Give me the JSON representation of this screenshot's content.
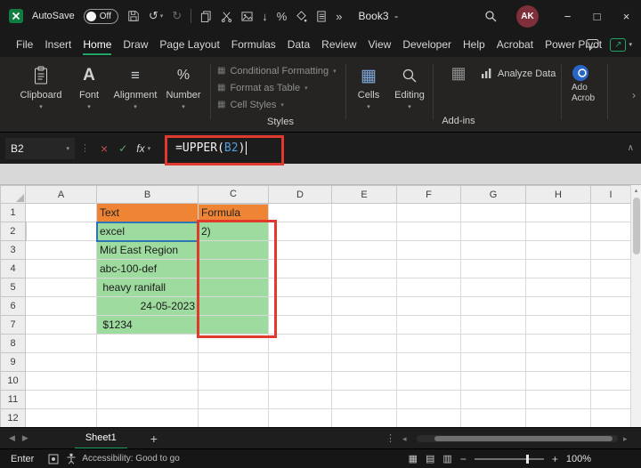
{
  "colors": {
    "excel_green": "#107C41",
    "accent_green": "#21A366",
    "header_orange": "#EE8434",
    "cell_green": "#9EDB9E",
    "annotation_red": "#E0392E",
    "reference_border_blue": "#2E75B6",
    "formula_ref_blue": "#569CD6"
  },
  "titlebar": {
    "autosave_label": "AutoSave",
    "autosave_state": "Off",
    "workbook_title": "Book3  -",
    "avatar_initials": "AK"
  },
  "menubar": {
    "items": [
      "File",
      "Insert",
      "Home",
      "Draw",
      "Page Layout",
      "Formulas",
      "Data",
      "Review",
      "View",
      "Developer",
      "Help",
      "Acrobat",
      "Power Pivot"
    ],
    "active_item": "Home"
  },
  "ribbon": {
    "groups": [
      {
        "label": "Clipboard"
      },
      {
        "label": "Font"
      },
      {
        "label": "Alignment"
      },
      {
        "label": "Number"
      }
    ],
    "styles_group": {
      "buttons": [
        "Conditional Formatting",
        "Format as Table",
        "Cell Styles"
      ],
      "label": "Styles"
    },
    "cells_group": {
      "label": "Cells"
    },
    "editing_group": {
      "label": "Editing"
    },
    "addins_group": {
      "label": "Add-ins"
    },
    "analyze_button": "Analyze Data",
    "adobe_line1": "Ado",
    "adobe_line2": "Acrob"
  },
  "formula_bar": {
    "name_box": "B2",
    "formula": {
      "prefix": "=UPPER(",
      "ref": "B2",
      "suffix": ")"
    }
  },
  "grid": {
    "columns": [
      "A",
      "B",
      "C",
      "D",
      "E",
      "F",
      "G",
      "H",
      "I"
    ],
    "rows": [
      {
        "n": "1",
        "b": "Text",
        "c": "Formula"
      },
      {
        "n": "2",
        "b": "excel",
        "c": "2)"
      },
      {
        "n": "3",
        "b": "Mid East Region",
        "c": ""
      },
      {
        "n": "4",
        "b": "abc-100-def",
        "c": ""
      },
      {
        "n": "5",
        "b": " heavy ranifall",
        "c": ""
      },
      {
        "n": "6",
        "b": "24-05-2023",
        "c": ""
      },
      {
        "n": "7",
        "b": " $1234",
        "c": ""
      },
      {
        "n": "8",
        "b": "",
        "c": ""
      },
      {
        "n": "9",
        "b": "",
        "c": ""
      },
      {
        "n": "10",
        "b": "",
        "c": ""
      },
      {
        "n": "11",
        "b": "",
        "c": ""
      },
      {
        "n": "12",
        "b": "",
        "c": ""
      }
    ]
  },
  "sheet_bar": {
    "tabs": [
      {
        "label": "Sheet1",
        "active": true
      }
    ],
    "add_sheet": "+"
  },
  "status_bar": {
    "mode": "Enter",
    "accessibility": "Accessibility: Good to go",
    "zoom_level": "100%"
  },
  "icons": {
    "chevron_down": "▾",
    "expand_formula_bar": "∧",
    "more_chevron": "›",
    "overflow": "»",
    "undo": "↺",
    "redo": "↻",
    "down_arrow": "↓",
    "percent": "%",
    "align_lines": "≡",
    "grid_glyph": "▦",
    "view_normal": "▦",
    "view_layout": "▤",
    "view_break": "▥",
    "close": "×",
    "minimize": "−",
    "maximize": "□",
    "cancel": "×",
    "check": "✓",
    "fx": "fx",
    "dots_v": "⋮",
    "nav_left": "◀",
    "nav_right": "▶",
    "scroll_left": "◂",
    "scroll_right": "▸",
    "scroll_up": "▴",
    "zoom_minus": "−",
    "zoom_plus": "+",
    "share_arrow": "↗",
    "font_a": "A"
  }
}
